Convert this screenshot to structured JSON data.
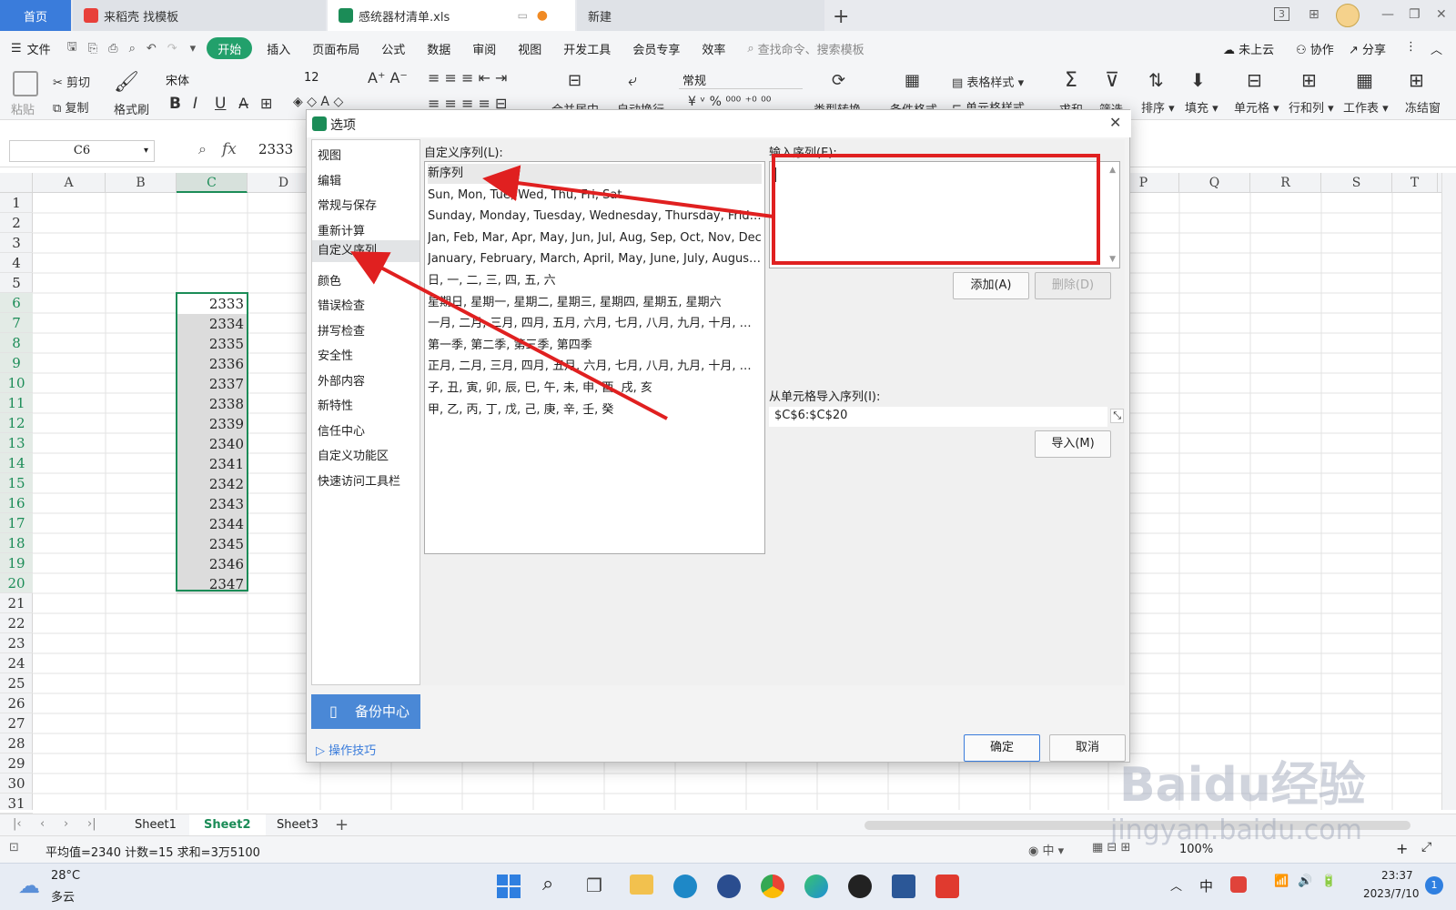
{
  "tabs": [
    {
      "label": "首页"
    },
    {
      "label": "来稻壳 找模板"
    },
    {
      "label": "感统器材清单.xls"
    },
    {
      "label": "新建"
    }
  ],
  "window": {
    "badge": "3"
  },
  "menubar": {
    "file": "文件",
    "items": [
      "开始",
      "插入",
      "页面布局",
      "公式",
      "数据",
      "审阅",
      "视图",
      "开发工具",
      "会员专享",
      "效率"
    ],
    "search_placeholder": "查找命令、搜索模板",
    "cloud": "未上云",
    "collab": "协作",
    "share": "分享"
  },
  "toolbar": {
    "paste": "粘贴",
    "cut": "剪切",
    "copy": "复制",
    "format_painter": "格式刷",
    "font": "宋体",
    "font_size": "12",
    "number_format": "常规",
    "merge": "合并居中",
    "wrap": "自动换行",
    "convert": "类型转换",
    "cond_format": "条件格式",
    "table_style": "表格样式",
    "cell_style": "单元格样式",
    "sum": "求和",
    "filter": "筛选",
    "sort": "排序",
    "fill": "填充",
    "cell": "单元格",
    "rowcol": "行和列",
    "worksheet": "工作表",
    "freeze": "冻结窗"
  },
  "formula": {
    "cell_ref": "C6",
    "fx": "fx",
    "value": "2333"
  },
  "grid": {
    "left_cols": [
      "A",
      "B",
      "C",
      "D"
    ],
    "right_cols": [
      "P",
      "Q",
      "R",
      "S",
      "T"
    ],
    "rows": [
      "1",
      "2",
      "3",
      "4",
      "5",
      "6",
      "7",
      "8",
      "9",
      "10",
      "11",
      "12",
      "13",
      "14",
      "15",
      "16",
      "17",
      "18",
      "19",
      "20",
      "21",
      "22",
      "23",
      "24",
      "25",
      "26",
      "27",
      "28",
      "29",
      "30",
      "31"
    ],
    "c_values": [
      "2333",
      "2334",
      "2335",
      "2336",
      "2337",
      "2338",
      "2339",
      "2340",
      "2341",
      "2342",
      "2343",
      "2344",
      "2345",
      "2346",
      "2347"
    ]
  },
  "sheets": [
    "Sheet1",
    "Sheet2",
    "Sheet3"
  ],
  "status": {
    "summary": "平均值=2340  计数=15  求和=3万5100",
    "zoom": "100%"
  },
  "dialog": {
    "title": "选项",
    "nav": [
      "视图",
      "编辑",
      "常规与保存",
      "重新计算",
      "自定义序列",
      "颜色",
      "错误检查",
      "拼写检查",
      "安全性",
      "外部内容",
      "新特性",
      "信任中心",
      "自定义功能区",
      "快速访问工具栏"
    ],
    "list_label": "自定义序列(L):",
    "sequences": [
      "新序列",
      "Sun, Mon, Tue, Wed, Thu, Fri, Sat",
      "Sunday, Monday, Tuesday, Wednesday, Thursday, Friday,...",
      "Jan, Feb, Mar, Apr, May, Jun, Jul, Aug, Sep, Oct, Nov, Dec",
      "January, February, March, April, May, June, July, August, ...",
      "日, 一, 二, 三, 四, 五, 六",
      "星期日, 星期一, 星期二, 星期三, 星期四, 星期五, 星期六",
      "一月, 二月, 三月, 四月, 五月, 六月, 七月, 八月, 九月, 十月, 十...",
      "第一季, 第二季, 第三季, 第四季",
      "正月, 二月, 三月, 四月, 五月, 六月, 七月, 八月, 九月, 十月, 十...",
      "子, 丑, 寅, 卯, 辰, 巳, 午, 未, 申, 酉, 戌, 亥",
      "甲, 乙, 丙, 丁, 戊, 己, 庚, 辛, 壬, 癸"
    ],
    "input_label": "输入序列(E):",
    "add": "添加(A)",
    "delete": "删除(D)",
    "import_label": "从单元格导入序列(I):",
    "import_value": "$C$6:$C$20",
    "import_btn": "导入(M)",
    "backup": "备份中心",
    "tips": "操作技巧",
    "ok": "确定",
    "cancel": "取消"
  },
  "taskbar": {
    "weather_temp": "28°C",
    "weather_desc": "多云",
    "ime": "中",
    "time": "23:37",
    "date": "2023/7/10",
    "notif": "1"
  },
  "watermark": {
    "brand": "Baidu经验",
    "url": "jingyan.baidu.com"
  },
  "colors": {
    "accent_green": "#1b8c57",
    "annotation_red": "#e02020",
    "home_tab": "#3a7cdb"
  }
}
